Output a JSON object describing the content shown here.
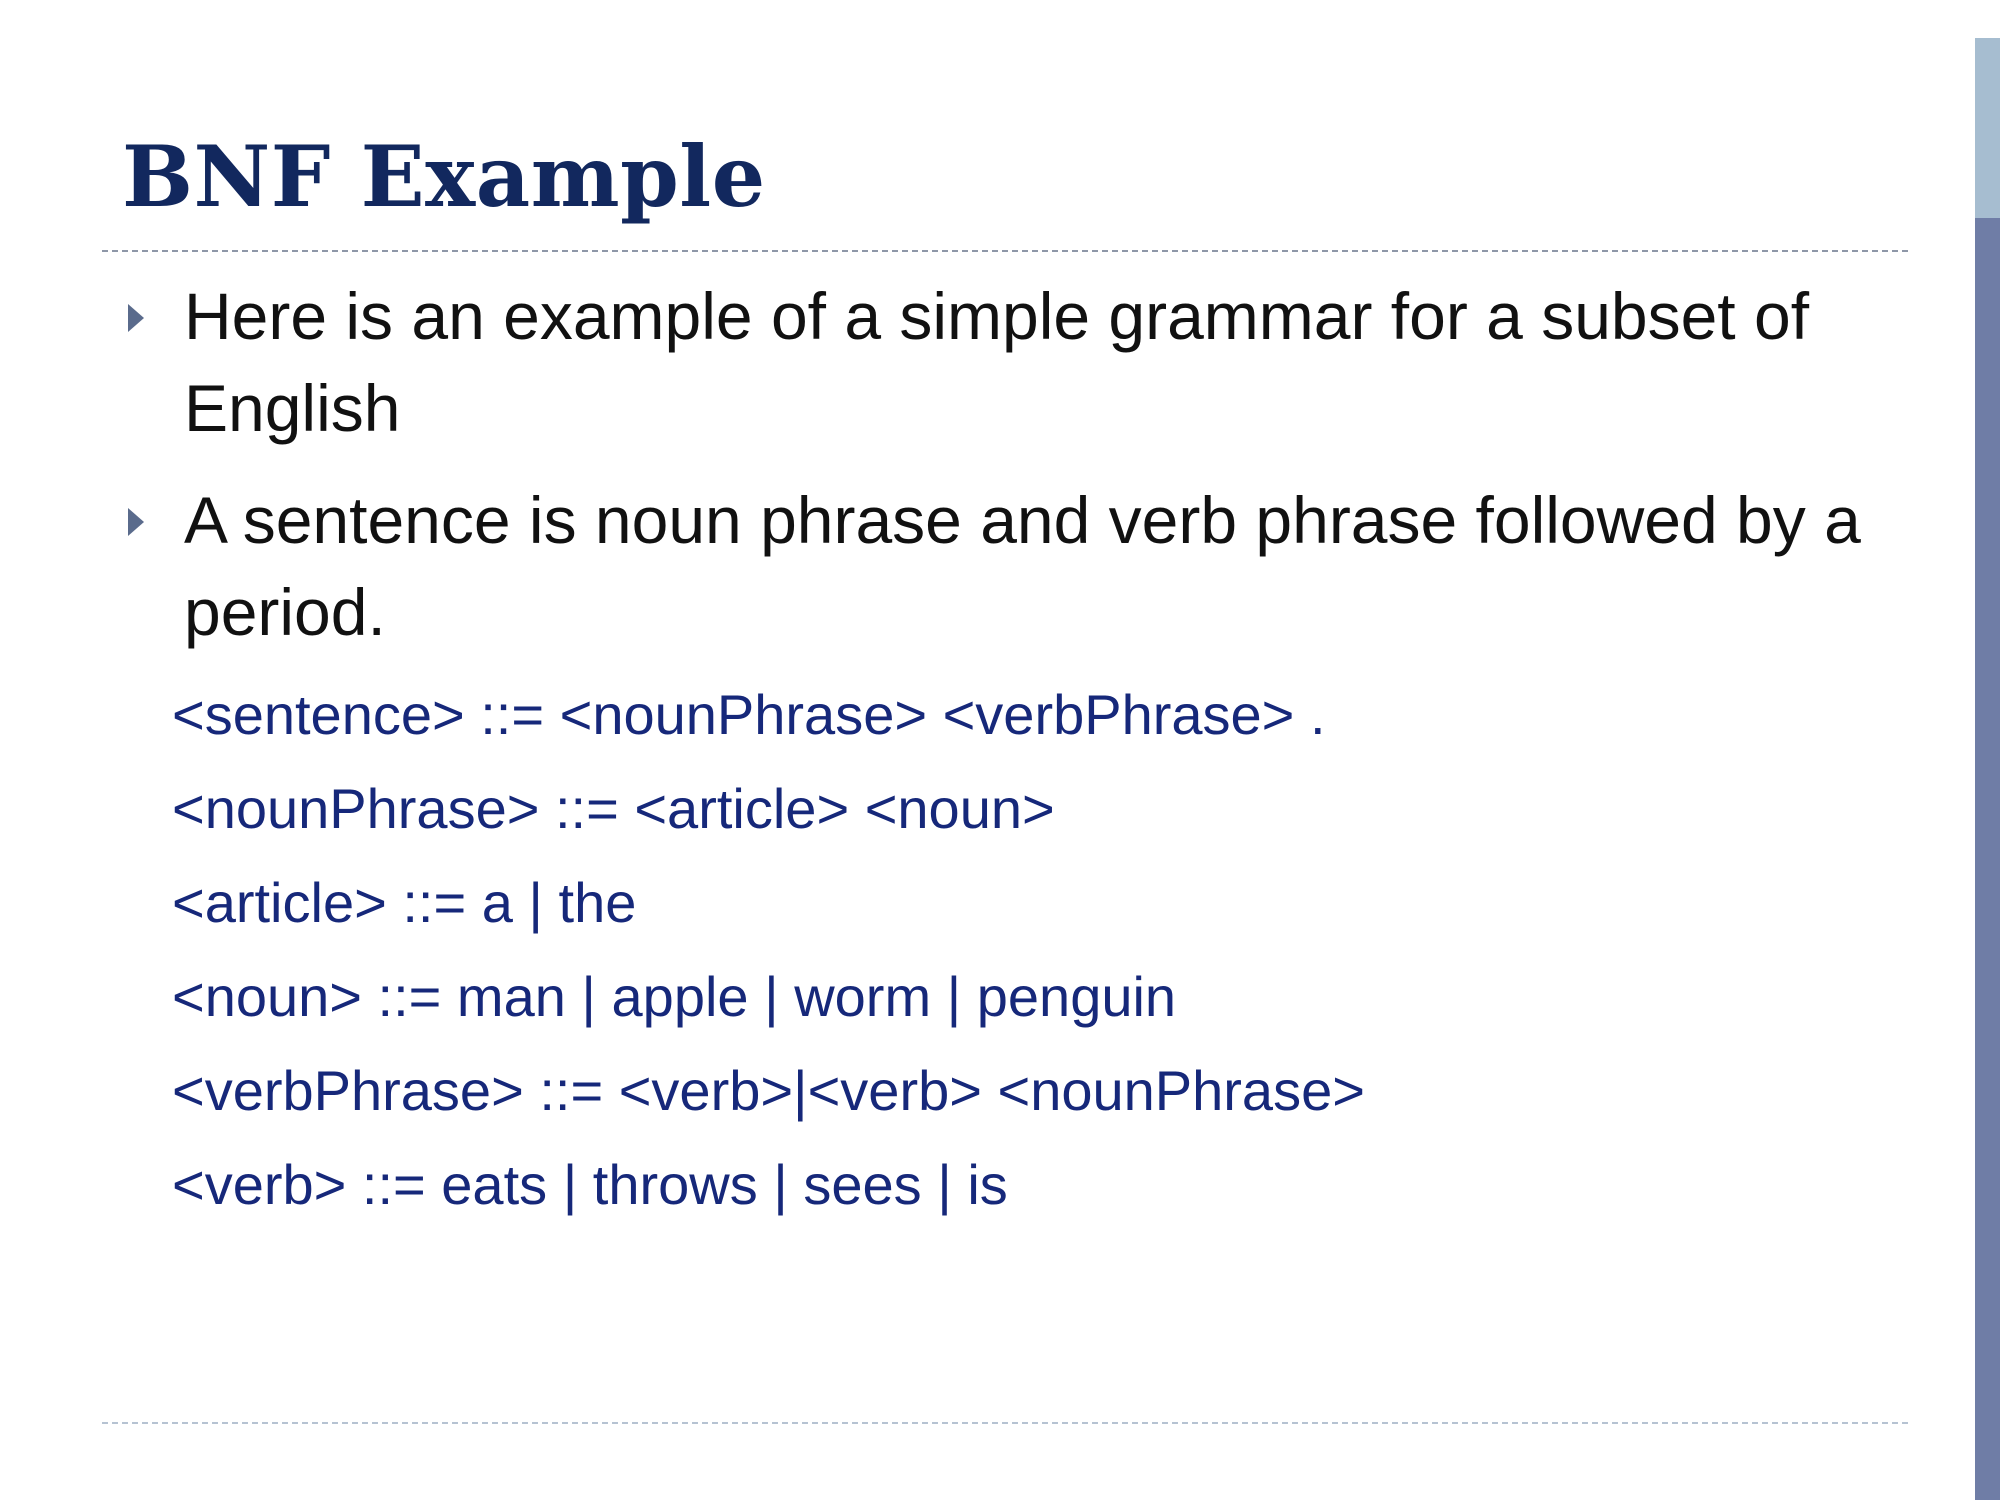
{
  "slide": {
    "title": "BNF Example",
    "bullets": [
      "Here is an example of a simple grammar for a subset of English",
      "A sentence is noun phrase and verb phrase followed by a period."
    ],
    "grammar_rules": [
      "<sentence> ::= <nounPhrase> <verbPhrase> .",
      "<nounPhrase> ::= <article> <noun>",
      "<article> ::= a | the",
      "<noun> ::= man | apple | worm | penguin",
      "<verbPhrase> ::= <verb>|<verb> <nounPhrase>",
      "<verb> ::= eats | throws | sees | is"
    ]
  },
  "colors": {
    "title": "#12285e",
    "body_text": "#111111",
    "grammar_text": "#16287a",
    "bullet_marker": "#5a6b8c",
    "side_bar_light": "#a6bdd0",
    "side_bar_dark": "#6f7da6"
  },
  "icons": {
    "bullet": "triangle-right-icon"
  }
}
